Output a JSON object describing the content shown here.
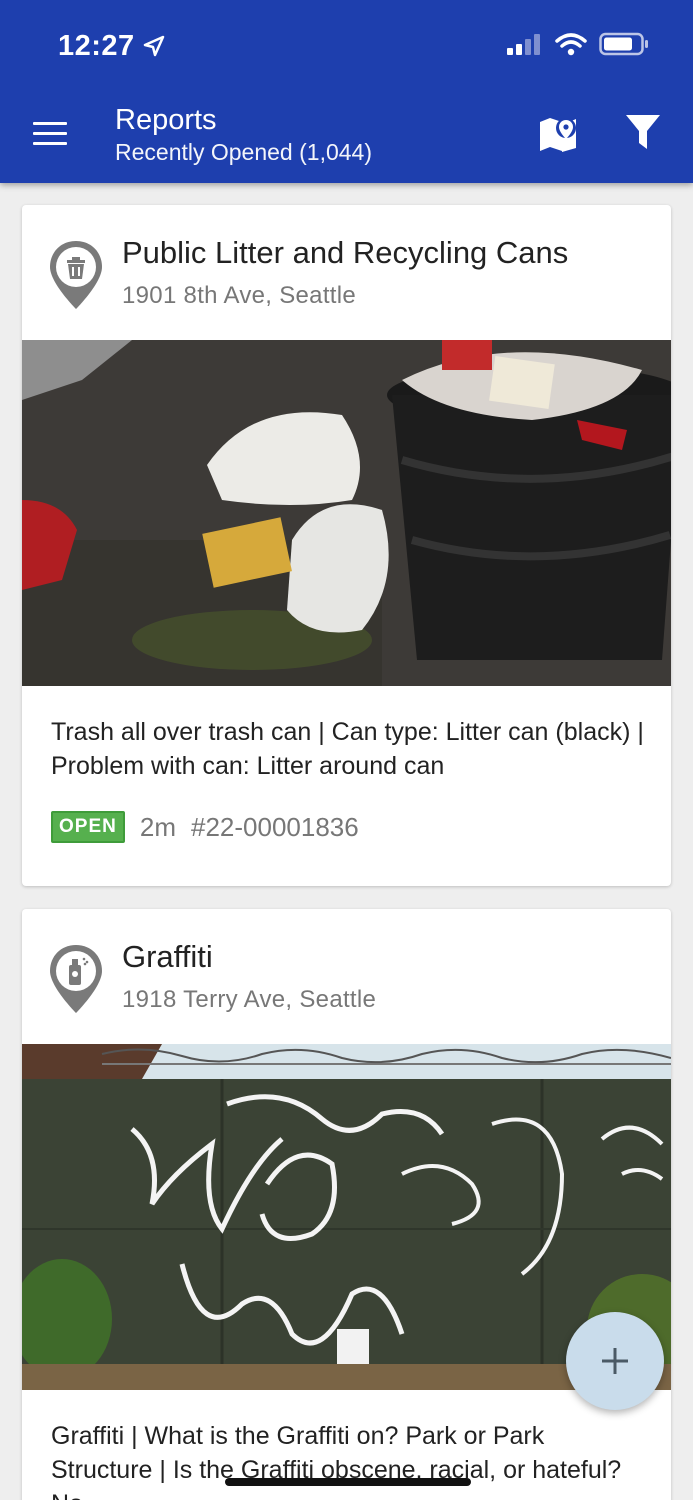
{
  "status_bar": {
    "time": "12:27"
  },
  "header": {
    "title": "Reports",
    "subtitle": "Recently Opened (1,044)",
    "menu_icon": "hamburger-menu-icon",
    "map_icon": "map-pin-icon",
    "filter_icon": "filter-funnel-icon"
  },
  "reports": [
    {
      "category": "Public Litter and Recycling Cans",
      "address": "1901 8th Ave, Seattle",
      "icon": "trash-can-pin-icon",
      "description": "Trash all over trash can | Can type: Litter can (black) | Problem with can: Litter around can",
      "status": "OPEN",
      "age": "2m",
      "number": "#22-00001836"
    },
    {
      "category": "Graffiti",
      "address": "1918 Terry Ave, Seattle",
      "icon": "spray-can-pin-icon",
      "description": "Graffiti | What is the Graffiti on? Park or Park Structure | Is the Graffiti obscene, racial, or hateful? No"
    }
  ],
  "fab": {
    "icon": "plus-icon",
    "label": "+"
  },
  "colors": {
    "app_bar": "#1e3fae",
    "open_badge": "#56b04e",
    "fab": "#c9dceb"
  }
}
